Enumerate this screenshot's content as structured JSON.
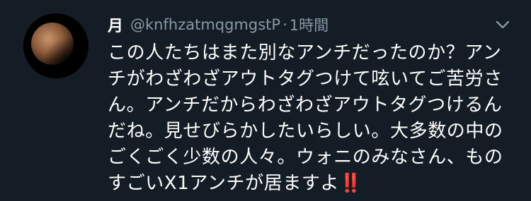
{
  "tweet": {
    "display_name": "月",
    "handle": "@knfhzatmqgmgstP",
    "separator": "·",
    "time": "1時間",
    "text": "この人たちはまた別なアンチだったのか？アンチがわざわざアウトタグつけて呟いてご苦労さん。アンチだからわざわざアウトタグつけるんだね。見せびらかしたいらしい。大多数の中のごくごく少数の人々。ウォニのみなさん、ものすごいX1アンチが居ますよ",
    "emoji": "‼️"
  },
  "icons": {
    "avatar": "lunar-eclipse-moon-avatar",
    "menu": "chevron-down-icon"
  },
  "colors": {
    "background": "#141d26",
    "primary_text": "#ffffff",
    "secondary_text": "#8899a6",
    "emoji": "#e0245e"
  }
}
